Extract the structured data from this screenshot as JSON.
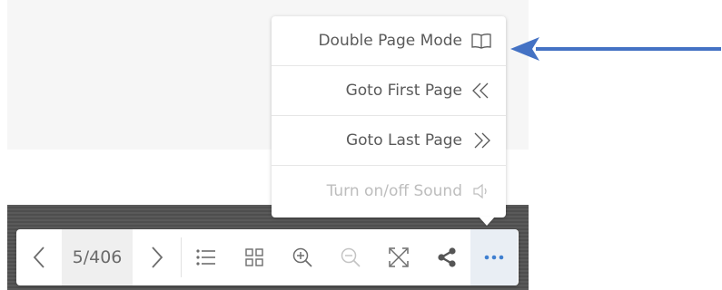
{
  "toolbar": {
    "page_indicator": "5/406"
  },
  "menu": {
    "items": [
      {
        "label": "Double Page Mode",
        "icon": "book-icon",
        "disabled": false
      },
      {
        "label": "Goto First Page",
        "icon": "double-chevron-left-icon",
        "disabled": false
      },
      {
        "label": "Goto Last Page",
        "icon": "double-chevron-right-icon",
        "disabled": false
      },
      {
        "label": "Turn on/off Sound",
        "icon": "speaker-icon",
        "disabled": true
      }
    ]
  },
  "colors": {
    "accent": "#3f7fd0",
    "annotation_arrow": "#4472c4",
    "icon_gray": "#6d6d6d",
    "disabled_gray": "#bdbdbd"
  }
}
